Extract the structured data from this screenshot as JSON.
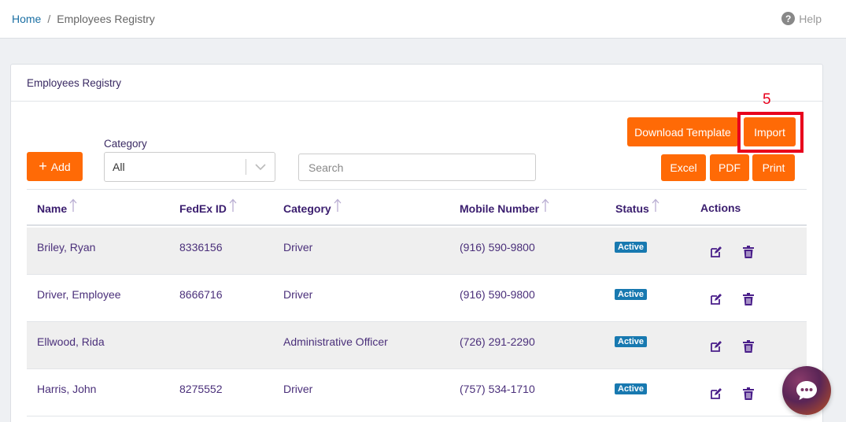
{
  "breadcrumb": {
    "home": "Home",
    "separator": "/",
    "current": "Employees Registry"
  },
  "help": {
    "icon": "question-circle-icon",
    "label": "Help"
  },
  "card": {
    "title": "Employees Registry"
  },
  "toolbar": {
    "add_label": "Add",
    "download_template_label": "Download Template",
    "import_label": "Import",
    "excel_label": "Excel",
    "pdf_label": "PDF",
    "print_label": "Print"
  },
  "annotation": {
    "number": "5",
    "color": "#e8001c"
  },
  "filter": {
    "category_label": "Category",
    "category_value": "All"
  },
  "search": {
    "placeholder": "Search"
  },
  "table": {
    "columns": [
      "Name",
      "FedEx ID",
      "Category",
      "Mobile Number",
      "Status",
      "Actions"
    ],
    "rows": [
      {
        "name": "Briley, Ryan",
        "fedex_id": "8336156",
        "category": "Driver",
        "mobile": "(916) 590-9800",
        "status": "Active"
      },
      {
        "name": "Driver, Employee",
        "fedex_id": "8666716",
        "category": "Driver",
        "mobile": "(916) 590-9800",
        "status": "Active"
      },
      {
        "name": "Ellwood, Rida",
        "fedex_id": "",
        "category": "Administrative Officer",
        "mobile": "(726) 291-2290",
        "status": "Active"
      },
      {
        "name": "Harris, John",
        "fedex_id": "8275552",
        "category": "Driver",
        "mobile": "(757) 534-1710",
        "status": "Active"
      }
    ]
  },
  "colors": {
    "accent": "#ff6a06",
    "header_text": "#3a1d6e",
    "badge": "#1879b0",
    "link": "#1a6fa3"
  }
}
